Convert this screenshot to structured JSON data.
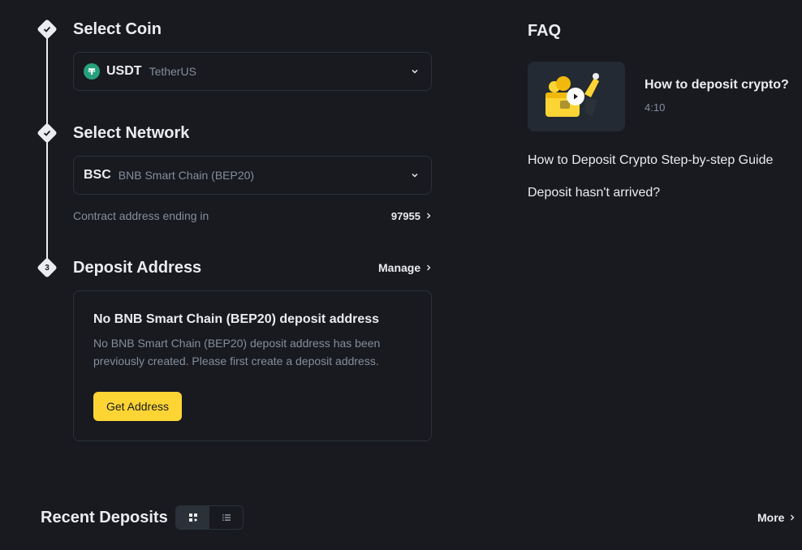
{
  "steps": {
    "coin": {
      "title": "Select Coin",
      "symbol": "USDT",
      "name": "TetherUS",
      "logo_icon": "tether-icon",
      "logo_color": "#26a17b"
    },
    "network": {
      "title": "Select Network",
      "code": "BSC",
      "name": "BNB Smart Chain (BEP20)",
      "contract_label": "Contract address ending in",
      "contract_value": "97955"
    },
    "address": {
      "number": "3",
      "title": "Deposit Address",
      "manage_label": "Manage",
      "card_title": "No BNB Smart Chain (BEP20) deposit address",
      "card_desc": "No BNB Smart Chain (BEP20) deposit address has been previously created. Please first create a deposit address.",
      "button_label": "Get Address"
    }
  },
  "faq": {
    "title": "FAQ",
    "video": {
      "title": "How to deposit crypto?",
      "duration": "4:10"
    },
    "links": [
      "How to Deposit Crypto Step-by-step Guide",
      "Deposit hasn't arrived?"
    ]
  },
  "recent": {
    "title": "Recent Deposits",
    "more_label": "More"
  },
  "colors": {
    "background": "#181a20",
    "accent": "#fcd535",
    "text_primary": "#eaecef",
    "text_secondary": "#848e9c",
    "border": "#2b3139"
  }
}
